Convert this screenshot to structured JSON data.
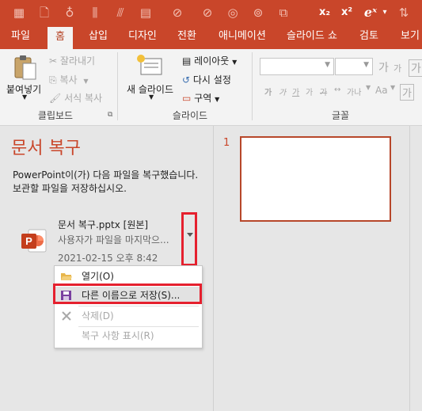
{
  "quick_access": {
    "icons": [
      "table-icon",
      "new-slide-icon",
      "format-icon",
      "align-icon",
      "align-center-icon",
      "chart-icon",
      "no-fill-icon",
      "shape-icon",
      "shape2-icon",
      "copy-format-icon"
    ],
    "subscript_label": "x₂",
    "superscript_label": "x²",
    "equation_label": "eˣ",
    "dropdown_glyph": "▾"
  },
  "tabs": [
    "파일",
    "홈",
    "삽입",
    "디자인",
    "전환",
    "애니메이션",
    "슬라이드 쇼",
    "검토",
    "보기"
  ],
  "active_tab": "홈",
  "ribbon": {
    "clipboard": {
      "paste_label": "붙여넣기",
      "cut_label": "잘라내기",
      "copy_label": "복사",
      "format_painter_label": "서식 복사",
      "group_label": "클립보드"
    },
    "slides": {
      "new_slide_label": "새 슬라이드",
      "layout_label": "레이아웃",
      "reset_label": "다시 설정",
      "section_label": "구역",
      "group_label": "슬라이드"
    },
    "font": {
      "font_name_value": "",
      "font_size_value": "",
      "grow_label": "가",
      "shrink_label": "가",
      "clear_label": "가",
      "bold_label": "가",
      "italic_label": "가",
      "underline_label": "가",
      "shadow_label": "가",
      "strike_label": "가",
      "spacing_label": "가나",
      "case_label": "Aa",
      "group_label": "글꼴"
    }
  },
  "recovery": {
    "title": "문서 복구",
    "description": "PowerPoint이(가) 다음 파일을 복구했습니다. 보관할 파일을 저장하십시오.",
    "file_name": "문서 복구.pptx  [원본]",
    "file_state": "사용자가 파일을 마지막으...",
    "file_date": "2021-02-15 오후 8:42"
  },
  "context_menu": {
    "items": [
      {
        "label": "열기(O)",
        "enabled": true
      },
      {
        "label": "다른 이름으로 저장(S)...",
        "enabled": true
      },
      {
        "label": "삭제(D)",
        "enabled": false
      },
      {
        "label": "복구 사항 표시(R)",
        "enabled": false
      }
    ]
  },
  "thumbnails": {
    "slide_number": "1"
  },
  "colors": {
    "accent": "#c9462a",
    "highlight_box": "#e5202e"
  }
}
